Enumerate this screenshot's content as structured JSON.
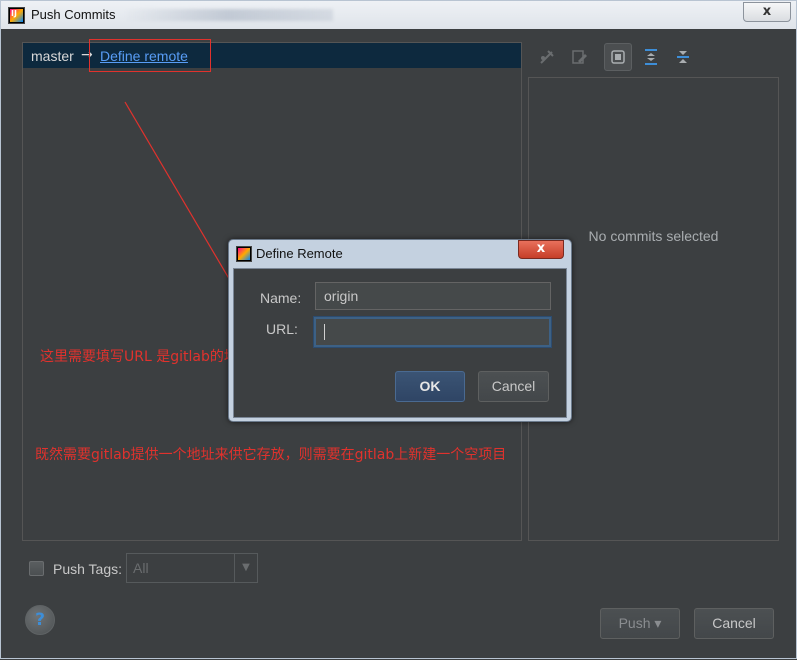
{
  "window": {
    "title": "Push Commits",
    "close_glyph": "x"
  },
  "branch": {
    "name": "master",
    "arrow": "→",
    "define_remote_label": "Define remote"
  },
  "toolbar": {
    "icons": [
      "cherry-pick-icon",
      "edit-icon",
      "show-details-icon",
      "expand-all-icon",
      "collapse-all-icon"
    ]
  },
  "details": {
    "empty_text": "No commits selected"
  },
  "annotations": {
    "url_note": "这里需要填写URL  是gitlab的地址",
    "gitlab_note": "既然需要gitlab提供一个地址来供它存放，则需要在gitlab上新建一个空项目",
    "color": "#e0322d"
  },
  "dialog": {
    "title": "Define Remote",
    "close_glyph": "x",
    "name_label": "Name:",
    "name_value": "origin",
    "url_label": "URL:",
    "url_value": "",
    "ok_label": "OK",
    "cancel_label": "Cancel"
  },
  "footer": {
    "push_tags_label": "Push Tags:",
    "tags_value": "All",
    "help_glyph": "?",
    "push_label": "Push ▾",
    "cancel_label": "Cancel"
  },
  "colors": {
    "background": "#3c3f41",
    "link": "#589df6",
    "selection": "#0d293e",
    "accent": "#3d6185"
  }
}
